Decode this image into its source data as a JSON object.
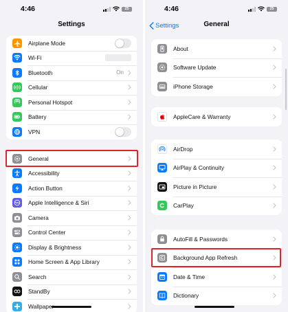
{
  "left": {
    "status": {
      "time": "4:46",
      "battery": "25"
    },
    "nav": {
      "title": "Settings"
    },
    "group1": [
      {
        "label": "Airplane Mode",
        "icon": "airplane-icon",
        "color": "#ff9500",
        "accessory": "toggle",
        "on": false
      },
      {
        "label": "Wi-Fi",
        "icon": "wifi-icon",
        "color": "#0a7aff",
        "accessory": "redacted"
      },
      {
        "label": "Bluetooth",
        "icon": "bluetooth-icon",
        "color": "#0a7aff",
        "accessory": "value",
        "value": "On"
      },
      {
        "label": "Cellular",
        "icon": "cellular-icon",
        "color": "#34c759",
        "accessory": "chevron"
      },
      {
        "label": "Personal Hotspot",
        "icon": "hotspot-icon",
        "color": "#34c759",
        "accessory": "chevron"
      },
      {
        "label": "Battery",
        "icon": "battery-icon",
        "color": "#34c759",
        "accessory": "chevron"
      },
      {
        "label": "VPN",
        "icon": "vpn-icon",
        "color": "#0a7aff",
        "accessory": "toggle",
        "on": false
      }
    ],
    "group2": [
      {
        "label": "General",
        "icon": "gear-icon",
        "color": "#8e8e93"
      },
      {
        "label": "Accessibility",
        "icon": "accessibility-icon",
        "color": "#0a7aff"
      },
      {
        "label": "Action Button",
        "icon": "action-button-icon",
        "color": "#0a7aff"
      },
      {
        "label": "Apple Intelligence & Siri",
        "icon": "siri-icon",
        "color": "#5e5ce6"
      },
      {
        "label": "Camera",
        "icon": "camera-icon",
        "color": "#8e8e93"
      },
      {
        "label": "Control Center",
        "icon": "control-center-icon",
        "color": "#8e8e93"
      },
      {
        "label": "Display & Brightness",
        "icon": "brightness-icon",
        "color": "#0a7aff"
      },
      {
        "label": "Home Screen & App Library",
        "icon": "home-screen-icon",
        "color": "#0a7aff"
      },
      {
        "label": "Search",
        "icon": "search-icon",
        "color": "#8e8e93"
      },
      {
        "label": "StandBy",
        "icon": "standby-icon",
        "color": "#111111"
      },
      {
        "label": "Wallpaper",
        "icon": "wallpaper-icon",
        "color": "#32ade6"
      }
    ]
  },
  "right": {
    "status": {
      "time": "4:46",
      "battery": "25"
    },
    "nav": {
      "back_label": "Settings",
      "title": "General"
    },
    "group1": [
      {
        "label": "About",
        "icon": "phone-info-icon",
        "color": "#8e8e93"
      },
      {
        "label": "Software Update",
        "icon": "software-update-icon",
        "color": "#8e8e93"
      },
      {
        "label": "iPhone Storage",
        "icon": "storage-icon",
        "color": "#8e8e93"
      }
    ],
    "group2": [
      {
        "label": "AppleCare & Warranty",
        "icon": "apple-logo-icon",
        "color": "#ffffff"
      }
    ],
    "group3": [
      {
        "label": "AirDrop",
        "icon": "airdrop-icon",
        "color": "#ffffff"
      },
      {
        "label": "AirPlay & Continuity",
        "icon": "airplay-icon",
        "color": "#0a7aff"
      },
      {
        "label": "Picture in Picture",
        "icon": "pip-icon",
        "color": "#111111"
      },
      {
        "label": "CarPlay",
        "icon": "carplay-icon",
        "color": "#34c759"
      }
    ],
    "group4": [
      {
        "label": "AutoFill & Passwords",
        "icon": "autofill-icon",
        "color": "#8e8e93"
      },
      {
        "label": "Background App Refresh",
        "icon": "app-refresh-icon",
        "color": "#8e8e93"
      },
      {
        "label": "Date & Time",
        "icon": "calendar-icon",
        "color": "#0a7aff"
      },
      {
        "label": "Dictionary",
        "icon": "dictionary-icon",
        "color": "#0a7aff"
      }
    ]
  },
  "highlight_color": "#e0232b"
}
